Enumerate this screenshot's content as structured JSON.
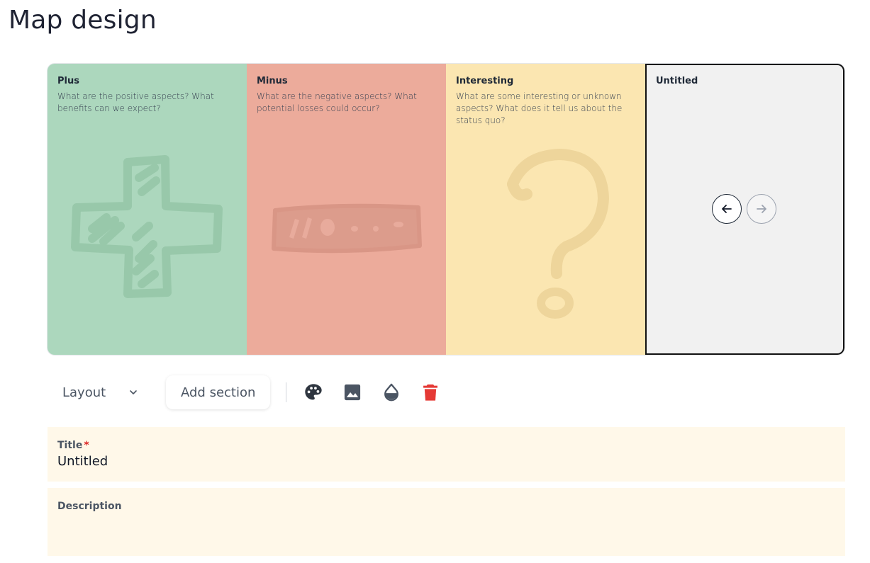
{
  "page": {
    "title": "Map design"
  },
  "map": {
    "sections": [
      {
        "title": "Plus",
        "description": "What are the positive aspects? What benefits can we expect?",
        "color": "#acd7bd",
        "icon": "plus-icon"
      },
      {
        "title": "Minus",
        "description": "What are the negative aspects? What potential losses could occur?",
        "color": "#ecab9b",
        "icon": "minus-icon"
      },
      {
        "title": "Interesting",
        "description": "What are some interesting or unknown aspects? What does it tell us about the status quo?",
        "color": "#fbe6b1",
        "icon": "question-mark-icon"
      },
      {
        "title": "Untitled",
        "description": "",
        "color": "#f1f1f1",
        "selected": true
      }
    ],
    "nav": {
      "prev_icon": "arrow-left-icon",
      "next_icon": "arrow-right-icon"
    }
  },
  "toolbar": {
    "layout_label": "Layout",
    "layout_icon": "chevron-down-icon",
    "add_section_label": "Add section",
    "tools": [
      "palette-icon",
      "image-icon",
      "opacity-drop-icon",
      "delete-icon"
    ],
    "delete_color": "#e53935"
  },
  "form": {
    "title": {
      "label": "Title",
      "required_mark": "*",
      "value": "Untitled"
    },
    "description": {
      "label": "Description",
      "value": ""
    }
  }
}
